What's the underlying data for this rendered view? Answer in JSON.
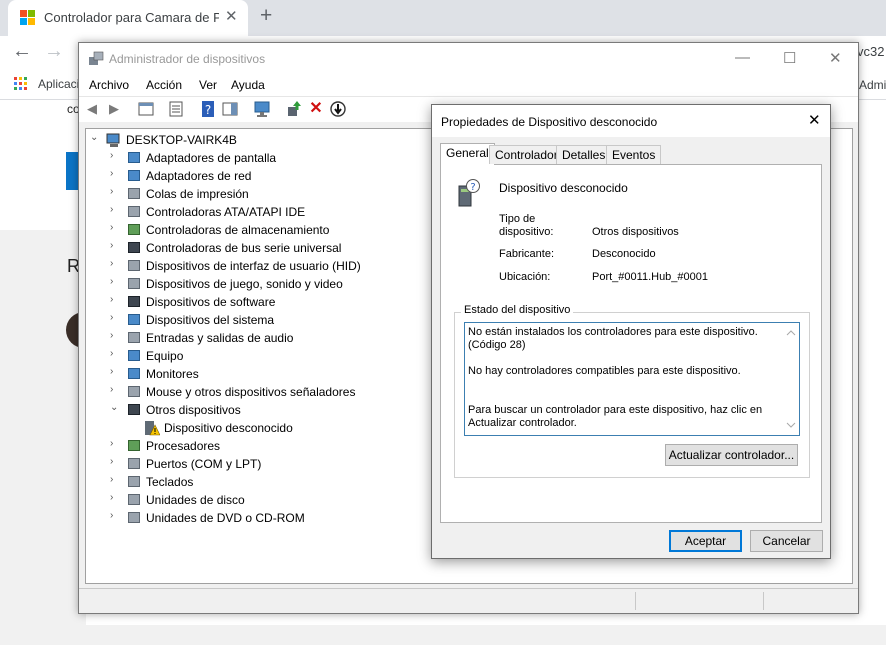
{
  "browser": {
    "tab_title": "Controlador para Camara de PC I",
    "tab_close": "✕",
    "new_tab": "+",
    "apps_label": "Aplicaci",
    "right_peek_top": "vc32",
    "right_peek_bookmarks": "Admi",
    "page_letter": "R",
    "page_fragment": "co"
  },
  "device_manager": {
    "title": "Administrador de dispositivos",
    "menu": [
      "Archivo",
      "Acción",
      "Ver",
      "Ayuda"
    ],
    "root": "DESKTOP-VAIRK4B",
    "tree": [
      {
        "label": "Adaptadores de pantalla",
        "icon": "display-adapter-icon"
      },
      {
        "label": "Adaptadores de red",
        "icon": "network-adapter-icon"
      },
      {
        "label": "Colas de impresión",
        "icon": "printer-icon"
      },
      {
        "label": "Controladoras ATA/ATAPI IDE",
        "icon": "ide-controller-icon"
      },
      {
        "label": "Controladoras de almacenamiento",
        "icon": "storage-controller-icon"
      },
      {
        "label": "Controladoras de bus serie universal",
        "icon": "usb-icon"
      },
      {
        "label": "Dispositivos de interfaz de usuario (HID)",
        "icon": "hid-icon"
      },
      {
        "label": "Dispositivos de juego, sonido y video",
        "icon": "speaker-icon"
      },
      {
        "label": "Dispositivos de software",
        "icon": "software-device-icon"
      },
      {
        "label": "Dispositivos del sistema",
        "icon": "system-device-icon"
      },
      {
        "label": "Entradas y salidas de audio",
        "icon": "audio-io-icon"
      },
      {
        "label": "Equipo",
        "icon": "computer-icon"
      },
      {
        "label": "Monitores",
        "icon": "monitor-icon"
      },
      {
        "label": "Mouse y otros dispositivos señaladores",
        "icon": "mouse-icon"
      },
      {
        "label": "Otros dispositivos",
        "icon": "unknown-device-icon",
        "expanded": true
      },
      {
        "label": "Dispositivo desconocido",
        "icon": "warning-device-icon",
        "child": true
      },
      {
        "label": "Procesadores",
        "icon": "processor-icon"
      },
      {
        "label": "Puertos (COM y LPT)",
        "icon": "port-icon"
      },
      {
        "label": "Teclados",
        "icon": "keyboard-icon"
      },
      {
        "label": "Unidades de disco",
        "icon": "disk-drive-icon"
      },
      {
        "label": "Unidades de DVD o CD-ROM",
        "icon": "dvd-drive-icon"
      }
    ]
  },
  "dialog": {
    "title": "Propiedades de Dispositivo desconocido",
    "tabs": [
      "General",
      "Controlador",
      "Detalles",
      "Eventos"
    ],
    "device_name": "Dispositivo desconocido",
    "props": {
      "type_label_1": "Tipo de",
      "type_label_2": "dispositivo:",
      "type_value": "Otros dispositivos",
      "maker_label": "Fabricante:",
      "maker_value": "Desconocido",
      "location_label": "Ubicación:",
      "location_value": "Port_#0011.Hub_#0001"
    },
    "status_group": "Estado del dispositivo",
    "status_lines": [
      "No están instalados los controladores para este dispositivo.",
      "(Código 28)",
      "No hay controladores compatibles para este dispositivo.",
      "Para buscar un controlador para este dispositivo, haz clic en",
      "Actualizar controlador."
    ],
    "update_button": "Actualizar controlador...",
    "ok_button": "Aceptar",
    "cancel_button": "Cancelar"
  }
}
